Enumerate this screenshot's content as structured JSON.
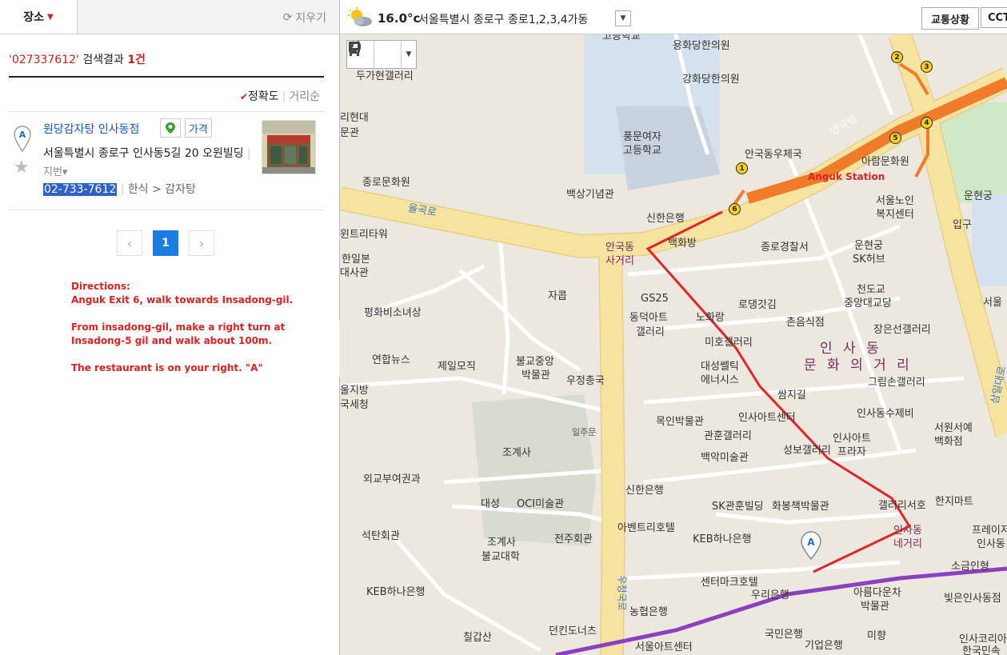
{
  "left_panel": {
    "tab_label": "장소",
    "clear_label": "지우기",
    "search": {
      "query": "'027337612'",
      "result_label": "검색결과",
      "count": "1건"
    },
    "sort": {
      "selected": "정확도",
      "other": "거리순"
    },
    "result": {
      "marker_letter": "A",
      "name": "원당감자탕 인사동점",
      "price_badge": "가격",
      "address": "서울특별시 종로구 인사동5길 20 오원빌딩",
      "jibun_label": "지번",
      "phone": "02-733-7612",
      "category": "한식 > 감자탕"
    },
    "pagination": {
      "prev": "‹",
      "current": "1",
      "next": "›"
    },
    "directions": {
      "heading": "Directions:",
      "line1": "Anguk Exit 6, walk towards Insadong-gil.",
      "line2": "From insadong-gil, make a right turn at Insadong-5 gil and walk about 100m.",
      "line3": "The restaurant is on your right. \"A\""
    }
  },
  "topbar": {
    "temperature": "16.0°c",
    "location": "서울특별시 종로구 종로1,2,3,4가동",
    "traffic_button": "교통상황",
    "cctv_button": "CCT"
  },
  "map": {
    "marker_letter": "A",
    "station_name": "안국역",
    "station_annotation": "Anguk Station",
    "road_labels": {
      "yulgok": "율곡로",
      "samil": "삼일대로",
      "ujeongguk": "우정국로"
    },
    "exits": [
      "1",
      "2",
      "3",
      "4",
      "5",
      "6"
    ],
    "district_label": [
      "인 사 동",
      "문 화 의 거 리"
    ],
    "intersection_anguk": [
      "안국동",
      "사거리"
    ],
    "intersection_insadong": [
      "인사동",
      "네거리"
    ],
    "places": {
      "p1": "고등학교",
      "p2": "용화당한의원",
      "p3": "두가현갤러리",
      "p4": "강화당한의원",
      "p5": "리현대",
      "p6": "문관",
      "p7": "풍문여자",
      "p8": "고등학교",
      "p9": "안국동우체국",
      "p10": "아람문화원",
      "p11": "운현궁",
      "p12": "종로문화원",
      "p13": "백상기념관",
      "p14": "신한은행",
      "p15": "서울노인",
      "p16": "복지센터",
      "p17": "입구",
      "p18": "윈트리타워",
      "p19": "백화방",
      "p20": "종로경찰서",
      "p21": "운현궁",
      "p22": "SK허브",
      "p23": "한일본",
      "p24": "대사관",
      "p25": "자콥",
      "p26": "GS25",
      "p27": "천도교",
      "p28": "중앙대교당",
      "p29": "서울",
      "p30": "평화비소녀상",
      "p31": "로댕갓김",
      "p32": "동덕아트",
      "p33": "갤러리",
      "p34": "노화랑",
      "p35": "촌음식점",
      "p36": "장은선갤러리",
      "p37": "미호갤러리",
      "p38": "연합뉴스",
      "p39": "제일모직",
      "p40": "불교중앙",
      "p41": "박물관",
      "p42": "대성쎌틱",
      "p43": "에너시스",
      "p44": "그림손갤러리",
      "p45": "울지방",
      "p46": "국세청",
      "p47": "우정총국",
      "p48": "쌈지길",
      "p49": "인사동수제비",
      "p50": "목인박물관",
      "p51": "인사아트센터",
      "p52": "일주문",
      "p53": "서원서예",
      "p54": "백화점",
      "p55": "조계사",
      "p56": "관훈갤러리",
      "p57": "인사아트",
      "p58": "프라자",
      "p59": "백악미술관",
      "p60": "성보갤러리",
      "p61": "외교부여권과",
      "p62": "신한은행",
      "p63": "대성",
      "p64": "OCI미술관",
      "p65": "SK관훈빌딩",
      "p66": "화봉책박물관",
      "p67": "갤러리서호",
      "p68": "한지마트",
      "p69": "석탄회관",
      "p70": "조계사",
      "p71": "불교대학",
      "p72": "아벤트리호텔",
      "p73": "전주회관",
      "p74": "프레이저",
      "p75": "인사동",
      "p76": "KEB하나은행",
      "p77": "소금인형",
      "p78": "KEB하나은행",
      "p79": "센터마크호텔",
      "p80": "우리은행",
      "p81": "아름다운차",
      "p82": "박물관",
      "p83": "빛은인사동점",
      "p84": "농협은행",
      "p85": "칠갑산",
      "p86": "던킨도너츠",
      "p87": "국민은행",
      "p88": "기업은행",
      "p89": "미향",
      "p90": "서울아트센터",
      "p91": "인사코리아",
      "p92": "한국민속"
    }
  },
  "colors": {
    "accent_red": "#d22222",
    "link_blue": "#1a56c6",
    "page_blue": "#1a7de1",
    "subway_orange": "#f07c2a",
    "road_yellow": "#f7e3a0",
    "route_red": "#e0262b",
    "purple_line": "#8e3fbf"
  }
}
